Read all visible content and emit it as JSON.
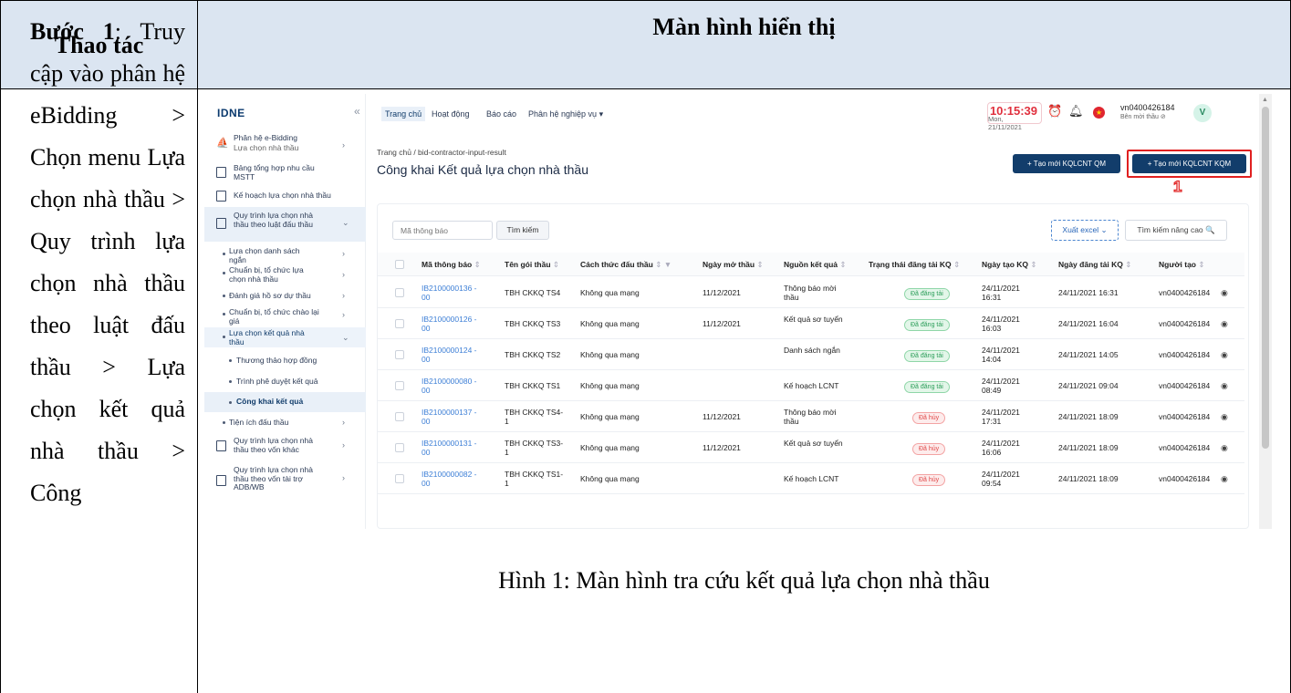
{
  "doc": {
    "header_left": "Thao tác",
    "header_right": "Màn hình hiển thị",
    "step_label": "Bước 1",
    "step_text": ": Truy cập vào phân hệ eBidding > Chọn menu Lựa chọn nhà thầu > Quy trình lựa chọn nhà thầu theo luật đấu thầu > Lựa chọn kết quả nhà thầu > Công",
    "caption": "Hình 1: Màn hình tra cứu kết quả lựa chọn nhà thầu"
  },
  "app": {
    "logo": "IDNE",
    "collapse_icon": "«",
    "sidebar": [
      {
        "label": "Phân hệ e-Bidding",
        "sub": "Lựa chọn nhà thầu"
      },
      {
        "label": "Bảng tổng hợp nhu cầu MSTT"
      },
      {
        "label": "Kế hoạch lựa chọn nhà thầu"
      },
      {
        "label": "Quy trình lựa chọn nhà thầu theo luật đấu thầu"
      },
      {
        "label": "Lựa chọn danh sách ngắn"
      },
      {
        "label": "Chuẩn bị, tổ chức lựa chọn nhà thầu"
      },
      {
        "label": "Đánh giá hồ sơ dự thầu"
      },
      {
        "label": "Chuẩn bị, tổ chức chào lại giá"
      },
      {
        "label": "Lựa chọn kết quả nhà thầu"
      },
      {
        "label": "Thương thảo hợp đồng"
      },
      {
        "label": "Trình phê duyệt kết quả"
      },
      {
        "label": "Công khai kết quả"
      },
      {
        "label": "Tiện ích đấu thầu"
      },
      {
        "label": "Quy trình lựa chọn nhà thầu theo vốn khác"
      },
      {
        "label": "Quy trình lựa chọn nhà thầu theo vốn tài trợ ADB/WB"
      }
    ],
    "topnav": [
      "Trang chủ",
      "Hoạt động",
      "Báo cáo",
      "Phân hệ nghiệp vụ ▾"
    ],
    "clock": {
      "time": "10:15:39",
      "date": "Mon, 21/11/2021"
    },
    "user": {
      "name": "vn0400426184",
      "role": "Bên mời thầu ⊘",
      "avatar": "V"
    },
    "breadcrumb": "Trang chủ  /  bid-contractor-input-result",
    "title": "Công khai Kết quả lựa chọn nhà thầu",
    "btn_qm": "+ Tạo mới KQLCNT QM",
    "btn_kqm": "+ Tạo mới KQLCNT KQM",
    "marker": "1",
    "search_placeholder": "Mã thông báo",
    "search_btn": "Tìm kiếm",
    "excel_btn": "Xuất excel ⌄",
    "adv_search": "Tìm kiếm nâng cao 🔍",
    "columns": [
      "Mã thông báo",
      "Tên gói thầu",
      "Cách thức đấu thầu",
      "Ngày mở thầu",
      "Nguồn kết quả",
      "Trạng thái đăng tải KQ",
      "Ngày tạo KQ",
      "Ngày đăng tải KQ",
      "Người tạo"
    ],
    "rows": [
      {
        "code": "IB2100000136 - 00",
        "name": "TBH CKKQ TS4",
        "method": "Không qua mạng",
        "open": "11/12/2021",
        "source": "Thông báo mời thầu",
        "status": "Đã đăng tải",
        "status_type": "ok",
        "created": "24/11/2021 16:31",
        "posted": "24/11/2021 16:31",
        "creator": "vn0400426184"
      },
      {
        "code": "IB2100000126 - 00",
        "name": "TBH CKKQ TS3",
        "method": "Không qua mạng",
        "open": "11/12/2021",
        "source": "Kết quả sơ tuyển",
        "status": "Đã đăng tải",
        "status_type": "ok",
        "created": "24/11/2021 16:03",
        "posted": "24/11/2021 16:04",
        "creator": "vn0400426184"
      },
      {
        "code": "IB2100000124 - 00",
        "name": "TBH CKKQ TS2",
        "method": "Không qua mạng",
        "open": "",
        "source": "Danh sách ngắn",
        "status": "Đã đăng tải",
        "status_type": "ok",
        "created": "24/11/2021 14:04",
        "posted": "24/11/2021 14:05",
        "creator": "vn0400426184"
      },
      {
        "code": "IB2100000080 - 00",
        "name": "TBH CKKQ TS1",
        "method": "Không qua mạng",
        "open": "",
        "source": "Kế hoạch LCNT",
        "status": "Đã đăng tải",
        "status_type": "ok",
        "created": "24/11/2021 08:49",
        "posted": "24/11/2021 09:04",
        "creator": "vn0400426184"
      },
      {
        "code": "IB2100000137 - 00",
        "name": "TBH CKKQ TS4- 1",
        "method": "Không qua mạng",
        "open": "11/12/2021",
        "source": "Thông báo mời thầu",
        "status": "Đã hủy",
        "status_type": "cancel",
        "created": "24/11/2021 17:31",
        "posted": "24/11/2021 18:09",
        "creator": "vn0400426184"
      },
      {
        "code": "IB2100000131 - 00",
        "name": "TBH CKKQ TS3- 1",
        "method": "Không qua mạng",
        "open": "11/12/2021",
        "source": "Kết quả sơ tuyển",
        "status": "Đã hủy",
        "status_type": "cancel",
        "created": "24/11/2021 16:06",
        "posted": "24/11/2021 18:09",
        "creator": "vn0400426184"
      },
      {
        "code": "IB2100000082 - 00",
        "name": "TBH CKKQ TS1- 1",
        "method": "Không qua mạng",
        "open": "",
        "source": "Kế hoạch LCNT",
        "status": "Đã hủy",
        "status_type": "cancel",
        "created": "24/11/2021 09:54",
        "posted": "24/11/2021 18:09",
        "creator": "vn0400426184"
      }
    ]
  }
}
